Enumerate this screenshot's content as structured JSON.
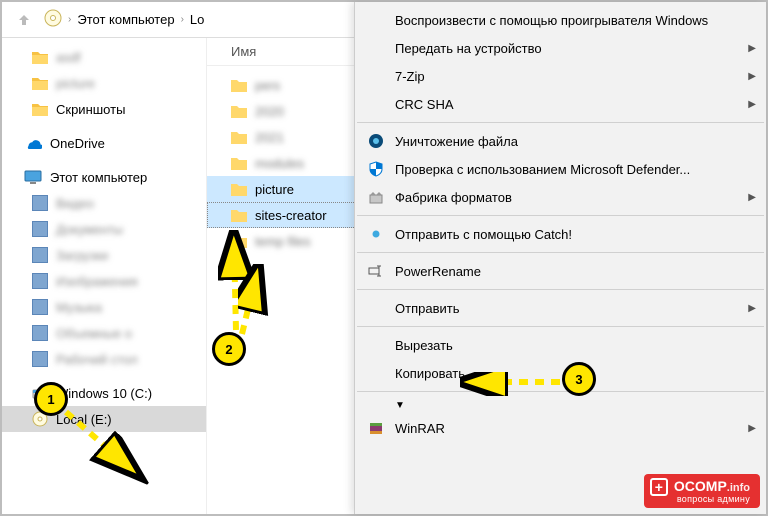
{
  "toolbar": {
    "crumb1": "Этот компьютер",
    "crumb2": "Lo"
  },
  "nav": {
    "blur1": "asdf",
    "blur2": "picture",
    "screenshots": "Скриншоты",
    "onedrive": "OneDrive",
    "thispc": "Этот компьютер",
    "b3": "Видео",
    "b4": "Документы",
    "b5": "Загрузки",
    "b6": "Изображения",
    "b7": "Музыка",
    "b8": "Объемные о",
    "b9": "Рабочий стол",
    "win_c": "Windows 10 (C:)",
    "local_e": "Local (E:)"
  },
  "content": {
    "header": "Имя",
    "r1": "pers",
    "r2": "2020",
    "r3": "2021",
    "r4": "modules",
    "picture": "picture",
    "sites": "sites-creator",
    "r6": "temp files"
  },
  "ctx": {
    "play": "Воспроизвести с помощью проигрывателя Windows",
    "cast": "Передать на устройство",
    "zip": "7-Zip",
    "crc": "CRC SHA",
    "destroy": "Уничтожение файла",
    "defender": "Проверка с использованием Microsoft Defender...",
    "factory": "Фабрика форматов",
    "catch": "Отправить с помощью Catch!",
    "powerrename": "PowerRename",
    "send": "Отправить",
    "cut": "Вырезать",
    "copy": "Копировать",
    "winrar": "WinRAR"
  },
  "markers": {
    "m1": "1",
    "m2": "2",
    "m3": "3"
  },
  "watermark": {
    "domain": "OCOMP",
    "tld": ".info",
    "sub": "вопросы админу"
  }
}
